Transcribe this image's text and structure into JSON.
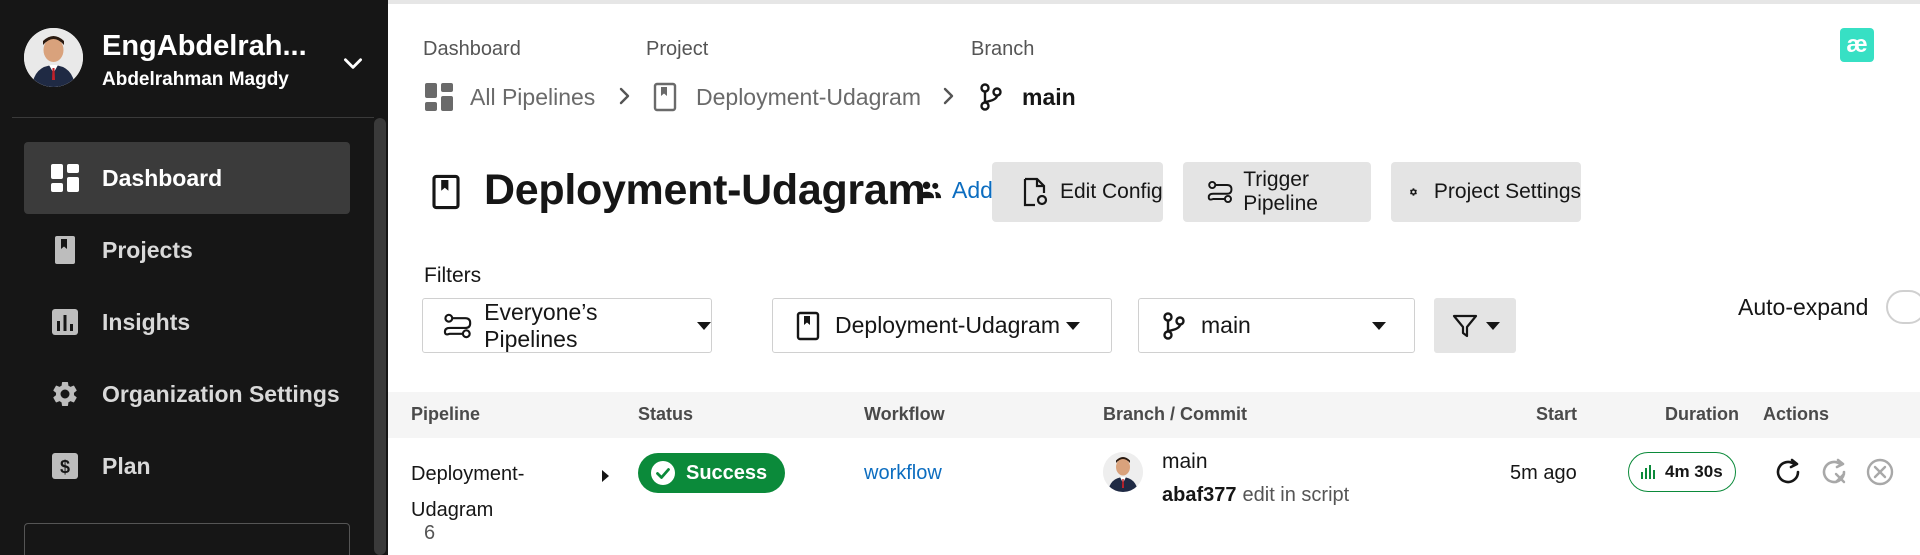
{
  "sidebar": {
    "user": {
      "name": "EngAbdelrah...",
      "full_name": "Abdelrahman Magdy"
    },
    "items": [
      {
        "label": "Dashboard",
        "icon": "dashboard-icon",
        "active": true
      },
      {
        "label": "Projects",
        "icon": "book-icon",
        "active": false
      },
      {
        "label": "Insights",
        "icon": "bar-chart-icon",
        "active": false
      },
      {
        "label": "Organization Settings",
        "icon": "gear-icon",
        "active": false
      },
      {
        "label": "Plan",
        "icon": "dollar-icon",
        "active": false
      }
    ]
  },
  "breadcrumb": {
    "dashboard_label": "Dashboard",
    "project_label": "Project",
    "branch_label": "Branch",
    "dashboard_value": "All Pipelines",
    "project_value": "Deployment-Udagram",
    "branch_value": "main"
  },
  "logo": {
    "text": "æ"
  },
  "header": {
    "title": "Deployment-Udagram",
    "add_team": "Add team members",
    "edit_config": "Edit Config",
    "trigger_pipeline": "Trigger Pipeline",
    "project_settings": "Project Settings"
  },
  "filters": {
    "label": "Filters",
    "pipelines": "Everyone’s Pipelines",
    "project": "Deployment-Udagram",
    "branch": "main",
    "auto_expand": "Auto-expand"
  },
  "table": {
    "headers": {
      "pipeline": "Pipeline",
      "status": "Status",
      "workflow": "Workflow",
      "branch_commit": "Branch / Commit",
      "start": "Start",
      "duration": "Duration",
      "actions": "Actions"
    },
    "rows": [
      {
        "pipeline": "Deployment-Udagram",
        "number": "6",
        "status": "Success",
        "workflow": "workflow",
        "branch": "main",
        "commit_hash": "abaf377",
        "commit_msg": "edit in script",
        "start": "5m ago",
        "duration": "4m 30s"
      }
    ]
  },
  "colors": {
    "sidebar_bg": "#161616",
    "success": "#0b8a3a",
    "link": "#0c6dc0",
    "logo": "#37e0c4"
  }
}
